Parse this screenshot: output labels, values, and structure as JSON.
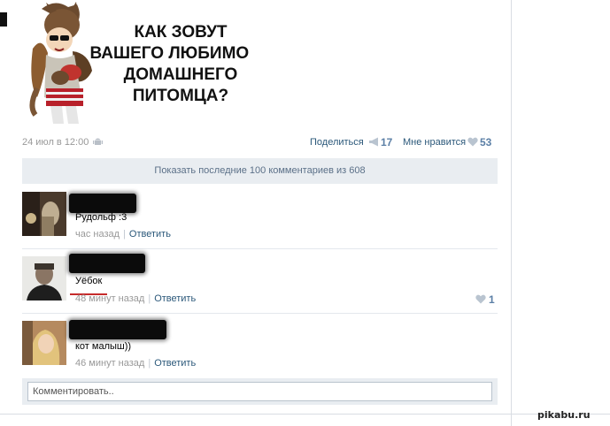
{
  "post": {
    "image_caption_lines": [
      "КАК ЗОВУТ",
      "ВАШЕГО ЛЮБИМОГО",
      "ДОМАШНЕГО",
      "ПИТОМЦА?"
    ],
    "date": "24 июл в 12:00",
    "platform_icon": "android-icon",
    "share_label": "Поделиться",
    "share_count": "17",
    "like_label": "Мне нравится",
    "like_count": "53"
  },
  "comments_header": {
    "show_more_label": "Показать последние 100 комментариев из 608"
  },
  "comments": [
    {
      "text": "Рудольф :3",
      "time": "час назад",
      "reply_label": "Ответить"
    },
    {
      "text": "Уёбок",
      "time": "48 минут назад",
      "reply_label": "Ответить",
      "likes": "1"
    },
    {
      "text": "кот малыш))",
      "time": "46 минут назад",
      "reply_label": "Ответить"
    }
  ],
  "composer": {
    "placeholder": "Комментировать.."
  },
  "watermark": "pikabu.ru",
  "colors": {
    "link": "#2b587a",
    "muted": "#999999",
    "panel": "#e9edf1",
    "count": "#5b7fa6"
  }
}
